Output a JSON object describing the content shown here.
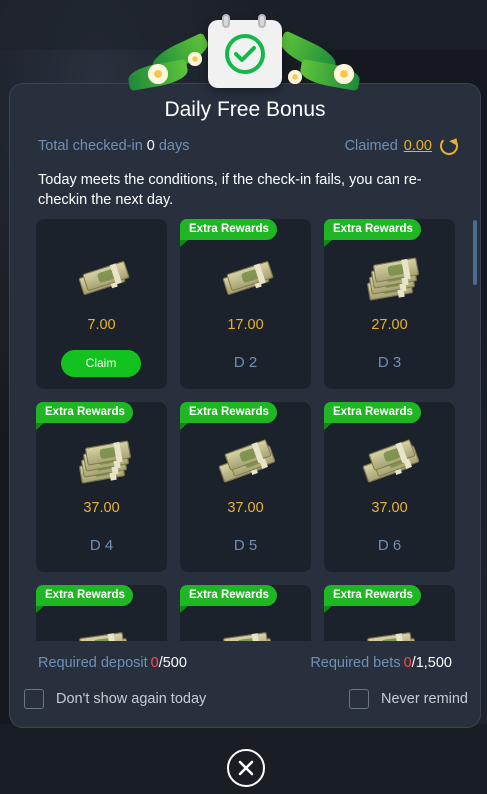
{
  "modal": {
    "title": "Daily Free Bonus",
    "total_checked_label": "Total checked-in",
    "total_checked_value": "0",
    "total_checked_unit": "days",
    "claimed_label": "Claimed",
    "claimed_value": "0.00",
    "notice": "Today meets the conditions, if the check-in fails, you can re-checkin the next day.",
    "extra_tag": "Extra Rewards",
    "claim_label": "Claim",
    "rewards": [
      {
        "amount": "7.00",
        "label": "Claim",
        "extra": false,
        "cash": "small"
      },
      {
        "amount": "17.00",
        "label": "D 2",
        "extra": true,
        "cash": "small"
      },
      {
        "amount": "27.00",
        "label": "D 3",
        "extra": true,
        "cash": "stack"
      },
      {
        "amount": "37.00",
        "label": "D 4",
        "extra": true,
        "cash": "stack"
      },
      {
        "amount": "37.00",
        "label": "D 5",
        "extra": true,
        "cash": "bundle"
      },
      {
        "amount": "37.00",
        "label": "D 6",
        "extra": true,
        "cash": "bundle"
      },
      {
        "amount": "",
        "label": "",
        "extra": true,
        "cash": "pile"
      },
      {
        "amount": "",
        "label": "",
        "extra": true,
        "cash": "pile"
      },
      {
        "amount": "",
        "label": "",
        "extra": true,
        "cash": "pile"
      }
    ],
    "required_deposit_label": "Required deposit",
    "required_deposit_current": "0",
    "required_deposit_total": "/500",
    "required_bets_label": "Required bets",
    "required_bets_current": "0",
    "required_bets_total": "/1,500",
    "dont_show_label": "Don't show again today",
    "never_remind_label": "Never remind"
  },
  "icons": {
    "calendar": "calendar-check-icon",
    "refresh": "refresh-icon",
    "close": "close-circle-icon",
    "cash": "cash-bundle-icon"
  },
  "colors": {
    "modal_bg": "#28303e",
    "card_bg": "#1c222c",
    "accent_gold": "#e8b32a",
    "accent_green": "#14c21f",
    "muted_blue": "#6f8fb5",
    "requirement_red": "#ff4b4b"
  }
}
